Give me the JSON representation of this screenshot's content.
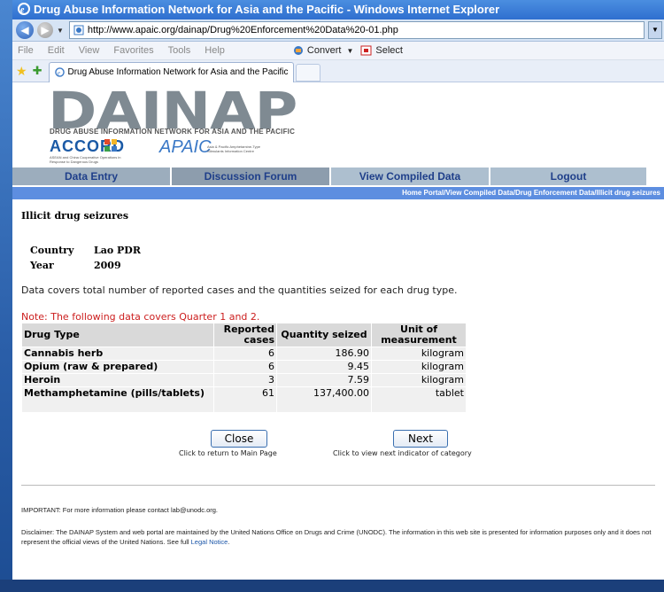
{
  "window": {
    "title": "Drug Abuse Information Network for Asia and the Pacific - Windows Internet Explorer",
    "url": "http://www.apaic.org/dainap/Drug%20Enforcement%20Data%20-01.php",
    "menu": [
      "File",
      "Edit",
      "View",
      "Favorites",
      "Tools",
      "Help"
    ],
    "convert_label": "Convert",
    "select_label": "Select",
    "tab_title": "Drug Abuse Information Network for Asia and the Pacific"
  },
  "banner": {
    "logo": "DAINAP",
    "logo_sub": "DRUG ABUSE INFORMATION NETWORK FOR ASIA AND THE PACIFIC",
    "accord": "ACCORD",
    "accord_sub": "ASEAN and China Cooperative Operations in Response to Dangerous Drugs",
    "apaic": "APAIC",
    "apaic_sub": "Asia & Pacific Amphetamine-Type Stimulants Information Centre"
  },
  "nav": [
    "Data Entry",
    "Discussion Forum",
    "View Compiled Data",
    "Logout"
  ],
  "breadcrumb": "Home Portal/View Compiled Data/Drug Enforcement Data/Illicit drug seizures",
  "page": {
    "title": "Illicit drug seizures",
    "country_label": "Country",
    "country": "Lao PDR",
    "year_label": "Year",
    "year": "2009",
    "description": "Data covers total number of reported cases and the quantities seized for each drug type.",
    "note": "Note: The following data covers Quarter 1 and 2."
  },
  "table": {
    "headers": [
      "Drug Type",
      "Reported cases",
      "Quantity seized",
      "Unit of measurement"
    ],
    "rows": [
      [
        "Cannabis herb",
        "6",
        "186.90",
        "kilogram"
      ],
      [
        "Opium (raw & prepared)",
        "6",
        "9.45",
        "kilogram"
      ],
      [
        "Heroin",
        "3",
        "7.59",
        "kilogram"
      ],
      [
        "Methamphetamine (pills/tablets)",
        "61",
        "137,400.00",
        "tablet"
      ]
    ]
  },
  "actions": {
    "close_label": "Close",
    "close_caption": "Click to return to Main Page",
    "next_label": "Next",
    "next_caption": "Click to view next indicator of category"
  },
  "footer": {
    "important": "IMPORTANT: For more information please contact lab@unodc.org.",
    "disclaimer": "Disclaimer: The DAINAP System and web portal are maintained by the United Nations Office on Drugs and Crime (UNODC). The information in this web site is presented for information purposes only and it does not represent the official views of the United Nations. See full ",
    "legal_link": "Legal Notice",
    "disclaimer_end": "."
  },
  "colors": {
    "accent": "#5d8ee0",
    "note": "#cc1e1e",
    "title_bar": "#2f6fcf"
  }
}
